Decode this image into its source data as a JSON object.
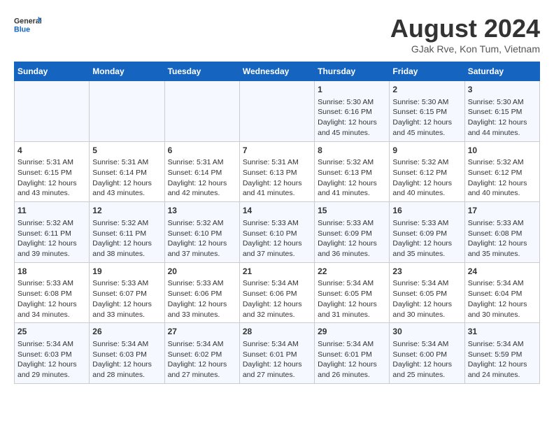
{
  "header": {
    "logo_general": "General",
    "logo_blue": "Blue",
    "month_title": "August 2024",
    "location": "GJak Rve, Kon Tum, Vietnam"
  },
  "days_of_week": [
    "Sunday",
    "Monday",
    "Tuesday",
    "Wednesday",
    "Thursday",
    "Friday",
    "Saturday"
  ],
  "weeks": [
    [
      {
        "day": "",
        "content": ""
      },
      {
        "day": "",
        "content": ""
      },
      {
        "day": "",
        "content": ""
      },
      {
        "day": "",
        "content": ""
      },
      {
        "day": "1",
        "content": "Sunrise: 5:30 AM\nSunset: 6:16 PM\nDaylight: 12 hours\nand 45 minutes."
      },
      {
        "day": "2",
        "content": "Sunrise: 5:30 AM\nSunset: 6:15 PM\nDaylight: 12 hours\nand 45 minutes."
      },
      {
        "day": "3",
        "content": "Sunrise: 5:30 AM\nSunset: 6:15 PM\nDaylight: 12 hours\nand 44 minutes."
      }
    ],
    [
      {
        "day": "4",
        "content": "Sunrise: 5:31 AM\nSunset: 6:15 PM\nDaylight: 12 hours\nand 43 minutes."
      },
      {
        "day": "5",
        "content": "Sunrise: 5:31 AM\nSunset: 6:14 PM\nDaylight: 12 hours\nand 43 minutes."
      },
      {
        "day": "6",
        "content": "Sunrise: 5:31 AM\nSunset: 6:14 PM\nDaylight: 12 hours\nand 42 minutes."
      },
      {
        "day": "7",
        "content": "Sunrise: 5:31 AM\nSunset: 6:13 PM\nDaylight: 12 hours\nand 41 minutes."
      },
      {
        "day": "8",
        "content": "Sunrise: 5:32 AM\nSunset: 6:13 PM\nDaylight: 12 hours\nand 41 minutes."
      },
      {
        "day": "9",
        "content": "Sunrise: 5:32 AM\nSunset: 6:12 PM\nDaylight: 12 hours\nand 40 minutes."
      },
      {
        "day": "10",
        "content": "Sunrise: 5:32 AM\nSunset: 6:12 PM\nDaylight: 12 hours\nand 40 minutes."
      }
    ],
    [
      {
        "day": "11",
        "content": "Sunrise: 5:32 AM\nSunset: 6:11 PM\nDaylight: 12 hours\nand 39 minutes."
      },
      {
        "day": "12",
        "content": "Sunrise: 5:32 AM\nSunset: 6:11 PM\nDaylight: 12 hours\nand 38 minutes."
      },
      {
        "day": "13",
        "content": "Sunrise: 5:32 AM\nSunset: 6:10 PM\nDaylight: 12 hours\nand 37 minutes."
      },
      {
        "day": "14",
        "content": "Sunrise: 5:33 AM\nSunset: 6:10 PM\nDaylight: 12 hours\nand 37 minutes."
      },
      {
        "day": "15",
        "content": "Sunrise: 5:33 AM\nSunset: 6:09 PM\nDaylight: 12 hours\nand 36 minutes."
      },
      {
        "day": "16",
        "content": "Sunrise: 5:33 AM\nSunset: 6:09 PM\nDaylight: 12 hours\nand 35 minutes."
      },
      {
        "day": "17",
        "content": "Sunrise: 5:33 AM\nSunset: 6:08 PM\nDaylight: 12 hours\nand 35 minutes."
      }
    ],
    [
      {
        "day": "18",
        "content": "Sunrise: 5:33 AM\nSunset: 6:08 PM\nDaylight: 12 hours\nand 34 minutes."
      },
      {
        "day": "19",
        "content": "Sunrise: 5:33 AM\nSunset: 6:07 PM\nDaylight: 12 hours\nand 33 minutes."
      },
      {
        "day": "20",
        "content": "Sunrise: 5:33 AM\nSunset: 6:06 PM\nDaylight: 12 hours\nand 33 minutes."
      },
      {
        "day": "21",
        "content": "Sunrise: 5:34 AM\nSunset: 6:06 PM\nDaylight: 12 hours\nand 32 minutes."
      },
      {
        "day": "22",
        "content": "Sunrise: 5:34 AM\nSunset: 6:05 PM\nDaylight: 12 hours\nand 31 minutes."
      },
      {
        "day": "23",
        "content": "Sunrise: 5:34 AM\nSunset: 6:05 PM\nDaylight: 12 hours\nand 30 minutes."
      },
      {
        "day": "24",
        "content": "Sunrise: 5:34 AM\nSunset: 6:04 PM\nDaylight: 12 hours\nand 30 minutes."
      }
    ],
    [
      {
        "day": "25",
        "content": "Sunrise: 5:34 AM\nSunset: 6:03 PM\nDaylight: 12 hours\nand 29 minutes."
      },
      {
        "day": "26",
        "content": "Sunrise: 5:34 AM\nSunset: 6:03 PM\nDaylight: 12 hours\nand 28 minutes."
      },
      {
        "day": "27",
        "content": "Sunrise: 5:34 AM\nSunset: 6:02 PM\nDaylight: 12 hours\nand 27 minutes."
      },
      {
        "day": "28",
        "content": "Sunrise: 5:34 AM\nSunset: 6:01 PM\nDaylight: 12 hours\nand 27 minutes."
      },
      {
        "day": "29",
        "content": "Sunrise: 5:34 AM\nSunset: 6:01 PM\nDaylight: 12 hours\nand 26 minutes."
      },
      {
        "day": "30",
        "content": "Sunrise: 5:34 AM\nSunset: 6:00 PM\nDaylight: 12 hours\nand 25 minutes."
      },
      {
        "day": "31",
        "content": "Sunrise: 5:34 AM\nSunset: 5:59 PM\nDaylight: 12 hours\nand 24 minutes."
      }
    ]
  ]
}
